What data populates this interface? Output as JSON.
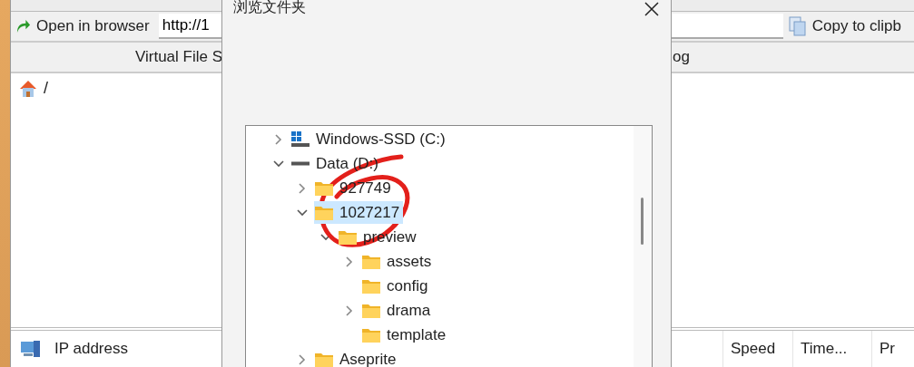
{
  "app": {
    "open_button": "Open in browser",
    "url_field": {
      "value": "http://1"
    },
    "copy_button": "Copy to clipb",
    "header": [
      "Virtual File S",
      "og"
    ],
    "path": "/",
    "bottom_columns": [
      "IP address",
      "Speed",
      "Time...",
      "Pr"
    ]
  },
  "dialog": {
    "title": "浏览文件夹",
    "tree": [
      {
        "label": "Windows-SSD (C:)",
        "kind": "system-drive",
        "expandable": true,
        "expanded": false,
        "selected": false
      },
      {
        "label": "Data (D:)",
        "kind": "drive",
        "expandable": true,
        "expanded": true,
        "selected": false,
        "children": [
          {
            "label": "927749",
            "kind": "folder",
            "expandable": true,
            "expanded": false,
            "selected": false
          },
          {
            "label": "1027217",
            "kind": "folder",
            "expandable": true,
            "expanded": true,
            "selected": true,
            "circled": true,
            "children": [
              {
                "label": "preview",
                "kind": "folder",
                "expandable": true,
                "expanded": true,
                "selected": false,
                "children": [
                  {
                    "label": "assets",
                    "kind": "folder",
                    "expandable": true,
                    "expanded": false,
                    "selected": false
                  },
                  {
                    "label": "config",
                    "kind": "folder",
                    "expandable": false,
                    "selected": false
                  },
                  {
                    "label": "drama",
                    "kind": "folder",
                    "expandable": true,
                    "expanded": false,
                    "selected": false
                  },
                  {
                    "label": "template",
                    "kind": "folder",
                    "expandable": false,
                    "selected": false
                  }
                ]
              }
            ]
          },
          {
            "label": "Aseprite",
            "kind": "folder",
            "expandable": true,
            "expanded": false,
            "selected": false
          }
        ]
      }
    ]
  }
}
